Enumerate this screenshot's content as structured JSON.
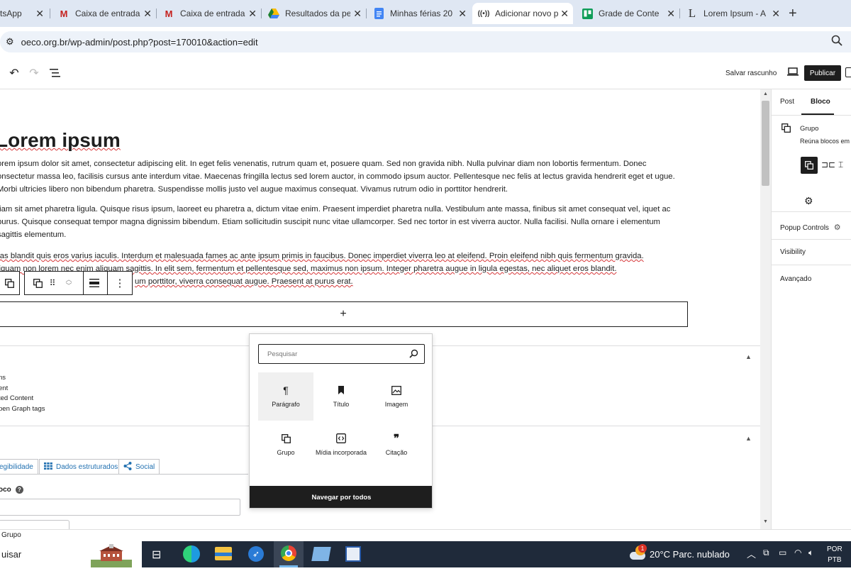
{
  "browser": {
    "tabs": [
      {
        "title": "tsApp",
        "favicon": "whatsapp-icon"
      },
      {
        "title": "Caixa de entrada",
        "favicon": "gmail-icon"
      },
      {
        "title": "Caixa de entrada",
        "favicon": "gmail-icon"
      },
      {
        "title": "Resultados da pe",
        "favicon": "drive-icon"
      },
      {
        "title": "Minhas férias 20",
        "favicon": "docs-icon"
      },
      {
        "title": "Adicionar novo p",
        "favicon": "broadcast-icon"
      },
      {
        "title": "Grade de Conte",
        "favicon": "trello-icon"
      },
      {
        "title": "Lorem Ipsum - A",
        "favicon": "lipsum-icon"
      }
    ],
    "url": "oeco.org.br/wp-admin/post.php?post=170010&action=edit"
  },
  "editor": {
    "save_draft": "Salvar rascunho",
    "publish": "Publicar",
    "title": "Lorem ipsum",
    "paragraphs": [
      "orem ipsum dolor sit amet, consectetur adipiscing elit. In eget felis venenatis, rutrum quam et, posuere quam. Sed non gravida nibh. Nulla pulvinar diam non lobortis fermentum. Donec onsectetur massa leo, facilisis cursus ante interdum vitae. Maecenas fringilla lectus sed lorem auctor, in commodo ipsum auctor. Pellentesque nec felis at lectus gravida hendrerit eget et ugue. Morbi ultricies libero non bibendum pharetra. Suspendisse mollis justo vel augue maximus consequat. Vivamus rutrum odio in porttitor hendrerit.",
      "tiam sit amet pharetra ligula. Quisque risus ipsum, laoreet eu pharetra a, dictum vitae enim. Praesent imperdiet pharetra nulla. Vestibulum ante massa, finibus sit amet consequat vel, iquet ac purus. Quisque consequat tempor magna dignissim bibendum. Etiam sollicitudin suscipit nunc vitae ullamcorper. Sed nec tortor in est viverra auctor. Nulla facilisi. Nulla ornare i elementum sagittis elementum."
    ],
    "para3_line1": "ras blandit quis eros varius iaculis. Interdum et malesuada fames ac ante ipsum primis in faucibus. Donec imperdiet viverra leo at eleifend. Proin eleifend nibh quis fermentum gravida.",
    "para3_line2": "liquam non lorem nec enim aliquam sagittis. In elit sem, fermentum et pellentesque sed, maximus non ipsum. Integer pharetra augue in ligula egestas, nec aliquet eros blandit.",
    "para3_line3": "um porttitor, viverra consequat augue. Praesent at purus erat.",
    "add_block_plus": "+"
  },
  "inserter": {
    "search_placeholder": "Pesquisar",
    "items": [
      {
        "label": "Parágrafo",
        "icon": "paragraph-icon"
      },
      {
        "label": "Título",
        "icon": "bookmark-icon"
      },
      {
        "label": "Imagem",
        "icon": "image-icon"
      },
      {
        "label": "Grupo",
        "icon": "group-icon"
      },
      {
        "label": "Mídia incorporada",
        "icon": "embed-icon"
      },
      {
        "label": "Citação",
        "icon": "quote-icon"
      }
    ],
    "browse_all": "Navegar por todos"
  },
  "meta": {
    "items": [
      "ns",
      "ent",
      "ted Content",
      "pen Graph tags"
    ],
    "tabs": [
      "egibilidade",
      "Dados estruturados",
      "Social"
    ],
    "field_label": "oco"
  },
  "sidebar": {
    "tab_post": "Post",
    "tab_block": "Bloco",
    "block_name": "Grupo",
    "block_desc": "Reúna blocos em",
    "popup_controls": "Popup Controls",
    "visibility": "Visibility",
    "advanced": "Avançado"
  },
  "footer": {
    "breadcrumb": "Grupo"
  },
  "taskbar": {
    "search": "uisar",
    "weather": "20°C  Parc. nublado",
    "lang_top": "POR",
    "lang_bottom": "PTB",
    "weather_badge": "1"
  },
  "colors": {
    "accent": "#1e1e1e",
    "tab_bg": "#dfe7f3",
    "taskbar": "#1f2a3a",
    "spell": "#d63638"
  }
}
